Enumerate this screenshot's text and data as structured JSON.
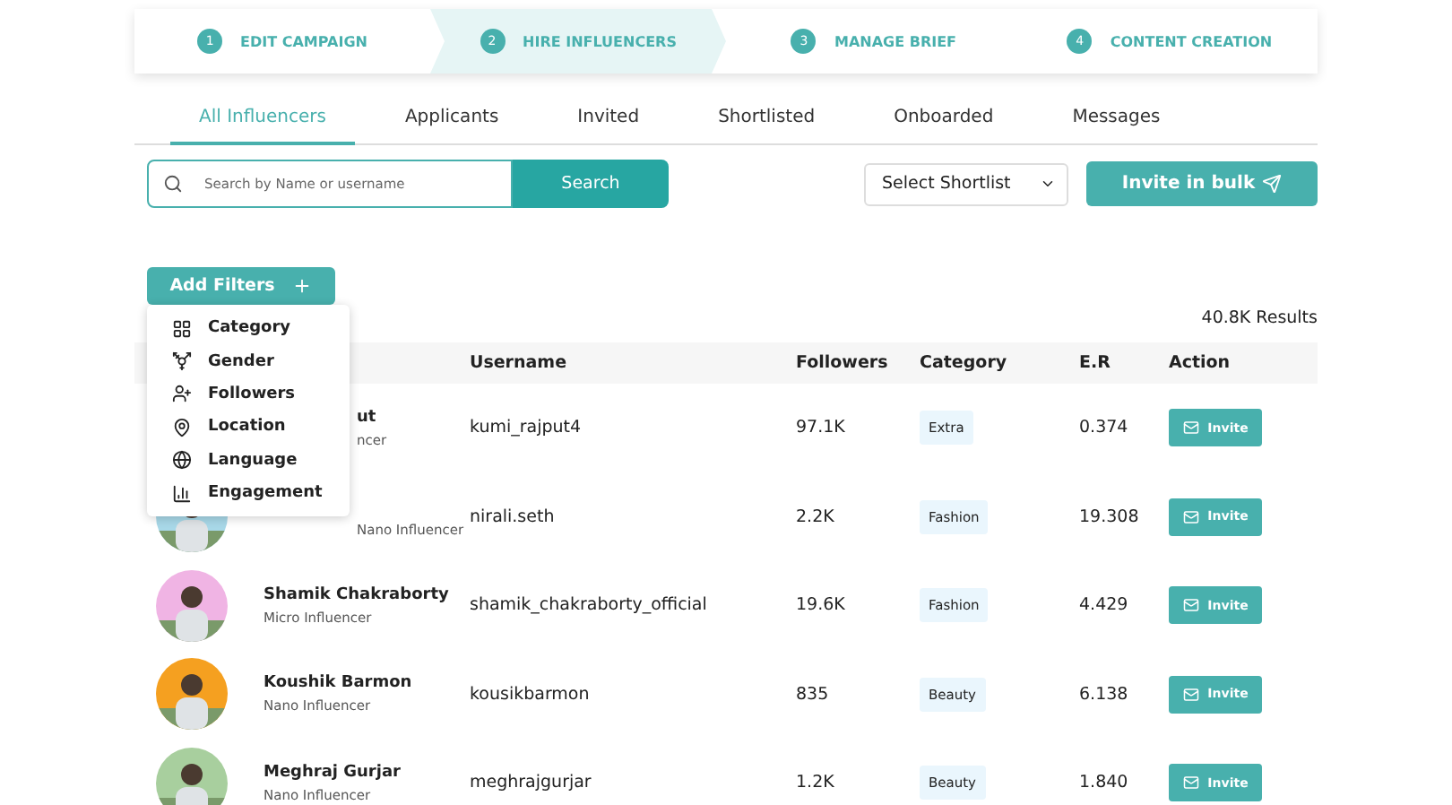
{
  "steps": [
    {
      "number": "1",
      "label": "EDIT CAMPAIGN",
      "selected": false
    },
    {
      "number": "2",
      "label": "HIRE INFLUENCERS",
      "selected": true
    },
    {
      "number": "3",
      "label": "MANAGE BRIEF",
      "selected": false
    },
    {
      "number": "4",
      "label": "CONTENT CREATION",
      "selected": false
    }
  ],
  "tabs": [
    {
      "label": "All Influencers",
      "selected": true
    },
    {
      "label": "Applicants",
      "selected": false
    },
    {
      "label": "Invited",
      "selected": false
    },
    {
      "label": "Shortlisted",
      "selected": false
    },
    {
      "label": "Onboarded",
      "selected": false
    },
    {
      "label": "Messages",
      "selected": false
    }
  ],
  "search": {
    "placeholder": "Search by Name or username",
    "button": "Search"
  },
  "shortlist_select": {
    "value": "Select Shortlist"
  },
  "invite_bulk": "Invite in bulk",
  "add_filters": "Add Filters",
  "filter_menu": [
    {
      "kind": "category",
      "label": "Category"
    },
    {
      "kind": "gender",
      "label": "Gender"
    },
    {
      "kind": "followers",
      "label": "Followers"
    },
    {
      "kind": "location",
      "label": "Location"
    },
    {
      "kind": "language",
      "label": "Language"
    },
    {
      "kind": "engagement",
      "label": "Engagement"
    }
  ],
  "results": "40.8K Results",
  "table": {
    "columns": [
      "Username",
      "Followers",
      "Category",
      "E.R",
      "Action"
    ],
    "rows": [
      {
        "name": "ut",
        "type": "ncer",
        "avatar": false,
        "covered": true,
        "username": "kumi_rajput4",
        "followers": "97.1K",
        "category": "Extra",
        "er": "0.374",
        "action": "Invite"
      },
      {
        "type": "Nano Influencer",
        "avatar": true,
        "covered": true,
        "username": "nirali.seth",
        "followers": "2.2K",
        "category": "Fashion",
        "er": "19.308",
        "action": "Invite"
      },
      {
        "name": "Shamik Chakraborty",
        "type": "Micro Influencer",
        "avatar": true,
        "covered": false,
        "username": "shamik_chakraborty_official",
        "followers": "19.6K",
        "category": "Fashion",
        "er": "4.429",
        "action": "Invite"
      },
      {
        "name": "Koushik Barmon",
        "type": "Nano Influencer",
        "avatar": true,
        "covered": false,
        "username": "kousikbarmon",
        "followers": "835",
        "category": "Beauty",
        "er": "6.138",
        "action": "Invite"
      },
      {
        "name": "Meghraj Gurjar",
        "type": "Nano Influencer",
        "avatar": true,
        "covered": false,
        "username": "meghrajgurjar",
        "followers": "1.2K",
        "category": "Beauty",
        "er": "1.840",
        "action": "Invite"
      }
    ]
  }
}
